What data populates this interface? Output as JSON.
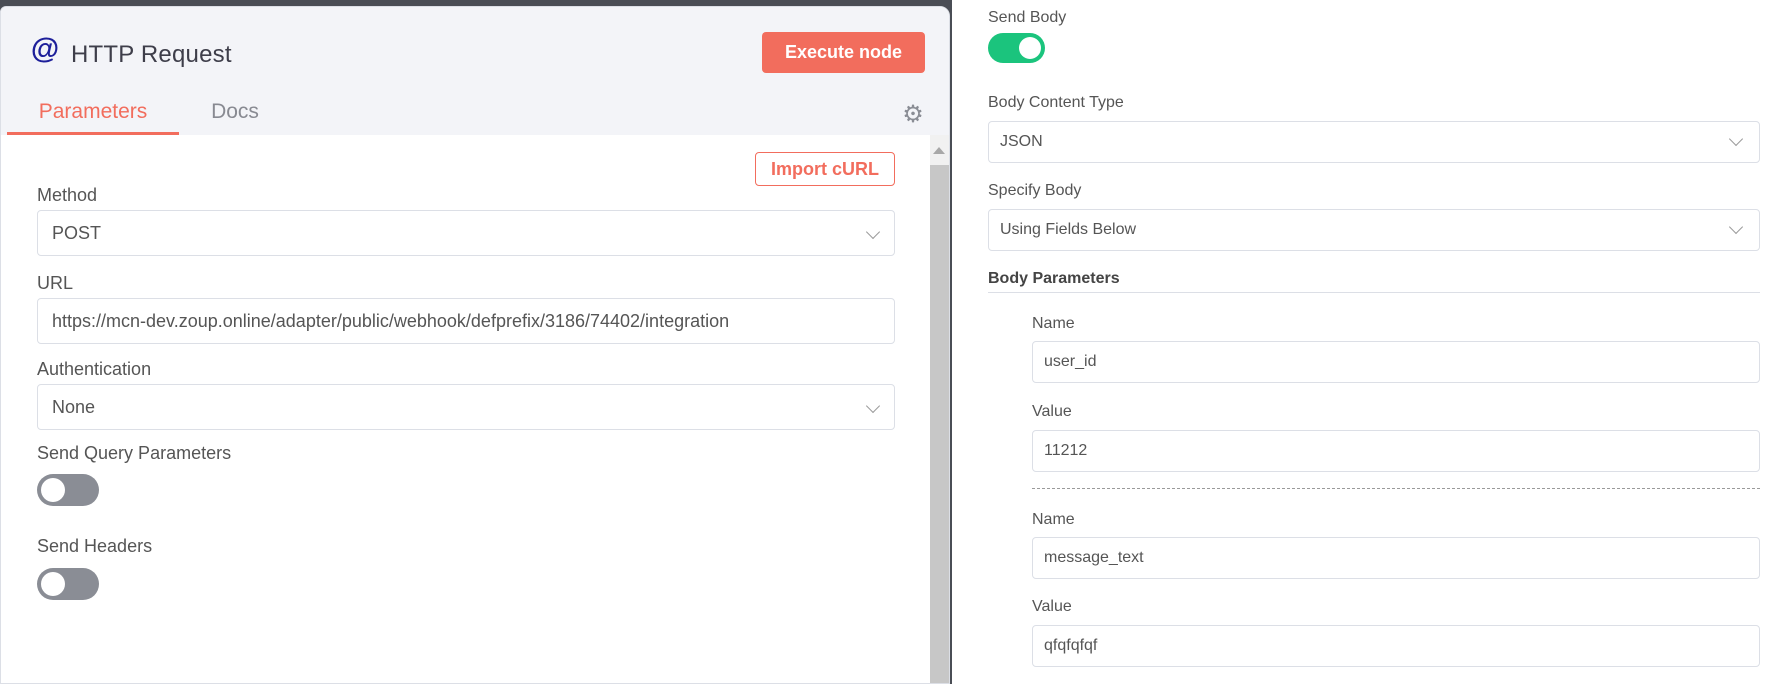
{
  "node": {
    "icon": "@",
    "title": "HTTP Request",
    "execute_label": "Execute node",
    "icons": {
      "node": "at-sign-icon",
      "settings": "gear-icon",
      "dropdown": "chevron-down-icon"
    }
  },
  "tabs": [
    {
      "label": "Parameters",
      "active": true
    },
    {
      "label": "Docs",
      "active": false
    }
  ],
  "import_curl_label": "Import cURL",
  "method": {
    "label": "Method",
    "value": "POST"
  },
  "url": {
    "label": "URL",
    "value": "https://mcn-dev.zoup.online/adapter/public/webhook/defprefix/3186/74402/integration"
  },
  "authentication": {
    "label": "Authentication",
    "value": "None"
  },
  "send_query": {
    "label": "Send Query Parameters",
    "enabled": false
  },
  "send_headers": {
    "label": "Send Headers",
    "enabled": false
  },
  "send_body": {
    "label": "Send Body",
    "enabled": true
  },
  "body_content_type": {
    "label": "Body Content Type",
    "value": "JSON"
  },
  "specify_body": {
    "label": "Specify Body",
    "value": "Using Fields Below"
  },
  "body_parameters": {
    "heading": "Body Parameters",
    "items": [
      {
        "name_label": "Name",
        "name": "user_id",
        "value_label": "Value",
        "value": "11212"
      },
      {
        "name_label": "Name",
        "name": "message_text",
        "value_label": "Value",
        "value": "qfqfqfqf"
      }
    ]
  },
  "colors": {
    "accent": "#f26d5d",
    "toggle_on": "#1bc47d",
    "toggle_off": "#8a8d95",
    "icon": "#1d1f9a"
  }
}
